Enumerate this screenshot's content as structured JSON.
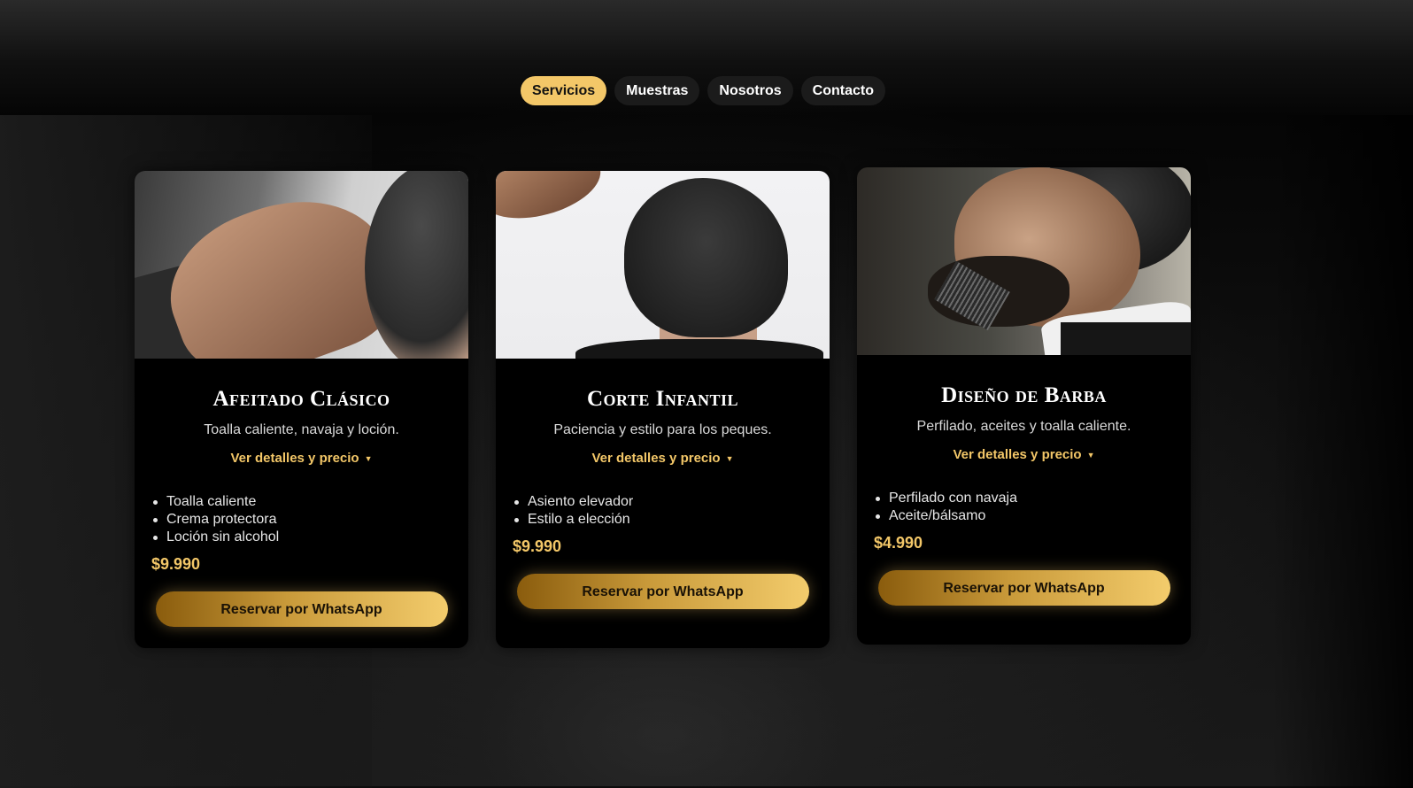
{
  "nav": {
    "items": [
      {
        "label": "Servicios",
        "active": true
      },
      {
        "label": "Muestras",
        "active": false
      },
      {
        "label": "Nosotros",
        "active": false
      },
      {
        "label": "Contacto",
        "active": false
      }
    ]
  },
  "cards": [
    {
      "title": "Afeitado Clásico",
      "description": "Toalla caliente, navaja y loción.",
      "details_label": "Ver detalles y precio",
      "features": [
        "Toalla caliente",
        "Crema protectora",
        "Loción sin alcohol"
      ],
      "price": "$9.990",
      "cta_label": "Reservar por WhatsApp"
    },
    {
      "title": "Corte Infantil",
      "description": "Paciencia y estilo para los peques.",
      "details_label": "Ver detalles y precio",
      "features": [
        "Asiento elevador",
        "Estilo a elección"
      ],
      "price": "$9.990",
      "cta_label": "Reservar por WhatsApp"
    },
    {
      "title": "Diseño de Barba",
      "description": "Perfilado, aceites y toalla caliente.",
      "details_label": "Ver detalles y precio",
      "features": [
        "Perfilado con navaja",
        "Aceite/bálsamo"
      ],
      "price": "$4.990",
      "cta_label": "Reservar por WhatsApp"
    }
  ],
  "colors": {
    "accent": "#f3c768",
    "card_bg": "#000000",
    "pill_bg": "#1b1b1b"
  }
}
